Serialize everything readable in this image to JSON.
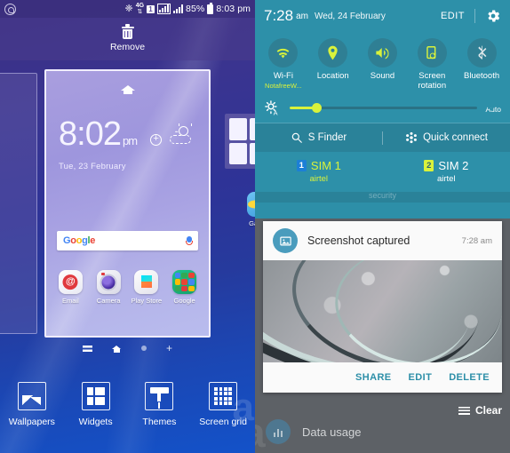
{
  "left_pane": {
    "status_bar": {
      "icons": [
        "whatsapp-icon",
        "bluetooth-icon",
        "4g-icon",
        "sim1-icon",
        "signal-bars-boxed-icon",
        "signal-bars-icon",
        "battery-icon"
      ],
      "network_label": "4G",
      "sim_label": "1",
      "battery": "85%",
      "time": "8:03 pm"
    },
    "remove_bar": {
      "label": "Remove",
      "icon": "trash-icon"
    },
    "home_preview": {
      "home_icon": "home-icon",
      "clock_time": "8:02",
      "clock_ampm": "pm",
      "clock_date": "Tue, 23 February",
      "weather_widget": "weather-add-widget",
      "search": {
        "brand": "Google",
        "g1": "G",
        "o1": "o",
        "o2": "o",
        "g2": "g",
        "l": "l",
        "e": "e",
        "mic_icon": "microphone-icon"
      },
      "dock_apps": [
        {
          "label": "Email",
          "icon": "email-app-icon"
        },
        {
          "label": "Camera",
          "icon": "camera-app-icon"
        },
        {
          "label": "Play Store",
          "icon": "play-store-app-icon"
        },
        {
          "label": "Google",
          "icon": "google-folder-icon"
        }
      ],
      "gallery_app": {
        "label": "Gallery",
        "icon": "gallery-app-icon"
      }
    },
    "page_indicators": [
      "list-page-icon",
      "home-page-icon",
      "dot-page-icon",
      "add-page-icon"
    ],
    "bottom_tools": [
      {
        "label": "Wallpapers",
        "icon": "wallpapers-icon"
      },
      {
        "label": "Widgets",
        "icon": "widgets-icon"
      },
      {
        "label": "Themes",
        "icon": "themes-icon"
      },
      {
        "label": "Screen grid",
        "icon": "screen-grid-icon"
      }
    ],
    "watermark": "a"
  },
  "right_pane": {
    "header": {
      "time": "7:28",
      "ampm": "am",
      "date": "Wed, 24 February",
      "edit_label": "EDIT",
      "settings_icon": "gear-icon"
    },
    "toggles": [
      {
        "label": "Wi-Fi",
        "sub": "NotafreeW...",
        "icon": "wifi-icon",
        "active": true
      },
      {
        "label": "Location",
        "sub": "",
        "icon": "location-pin-icon",
        "active": true
      },
      {
        "label": "Sound",
        "sub": "",
        "icon": "sound-speaker-icon",
        "active": true
      },
      {
        "label": "Screen rotation",
        "sub": "",
        "icon": "screen-rotation-icon",
        "active": true
      },
      {
        "label": "Bluetooth",
        "sub": "",
        "icon": "bluetooth-icon",
        "active": false
      }
    ],
    "brightness": {
      "icon": "brightness-auto-icon",
      "value_percent": 14,
      "auto_label": "Auto",
      "auto_checked": true
    },
    "finder_row": [
      {
        "label": "S Finder",
        "icon": "search-icon"
      },
      {
        "label": "Quick connect",
        "icon": "quick-connect-icon"
      }
    ],
    "sims": [
      {
        "badge": "1",
        "name": "SIM 1",
        "carrier": "airtel"
      },
      {
        "badge": "2",
        "name": "SIM 2",
        "carrier": "airtel"
      }
    ],
    "ghost_text": "security",
    "notification": {
      "icon": "image-icon",
      "title": "Screenshot captured",
      "time": "7:28 am",
      "preview_image": "screenshot-thumbnail",
      "actions": [
        "SHARE",
        "EDIT",
        "DELETE"
      ]
    },
    "clear": {
      "label": "Clear",
      "icon": "clear-all-icon"
    },
    "data_usage": {
      "label": "Data usage",
      "icon": "data-usage-icon"
    },
    "watermark": "a"
  },
  "colors": {
    "quick_panel_bg": "#2d90a9",
    "accent_yellow": "#d9f23b",
    "accent_teal": "#2d8fa8",
    "dim_overlay": "#5d6166"
  }
}
